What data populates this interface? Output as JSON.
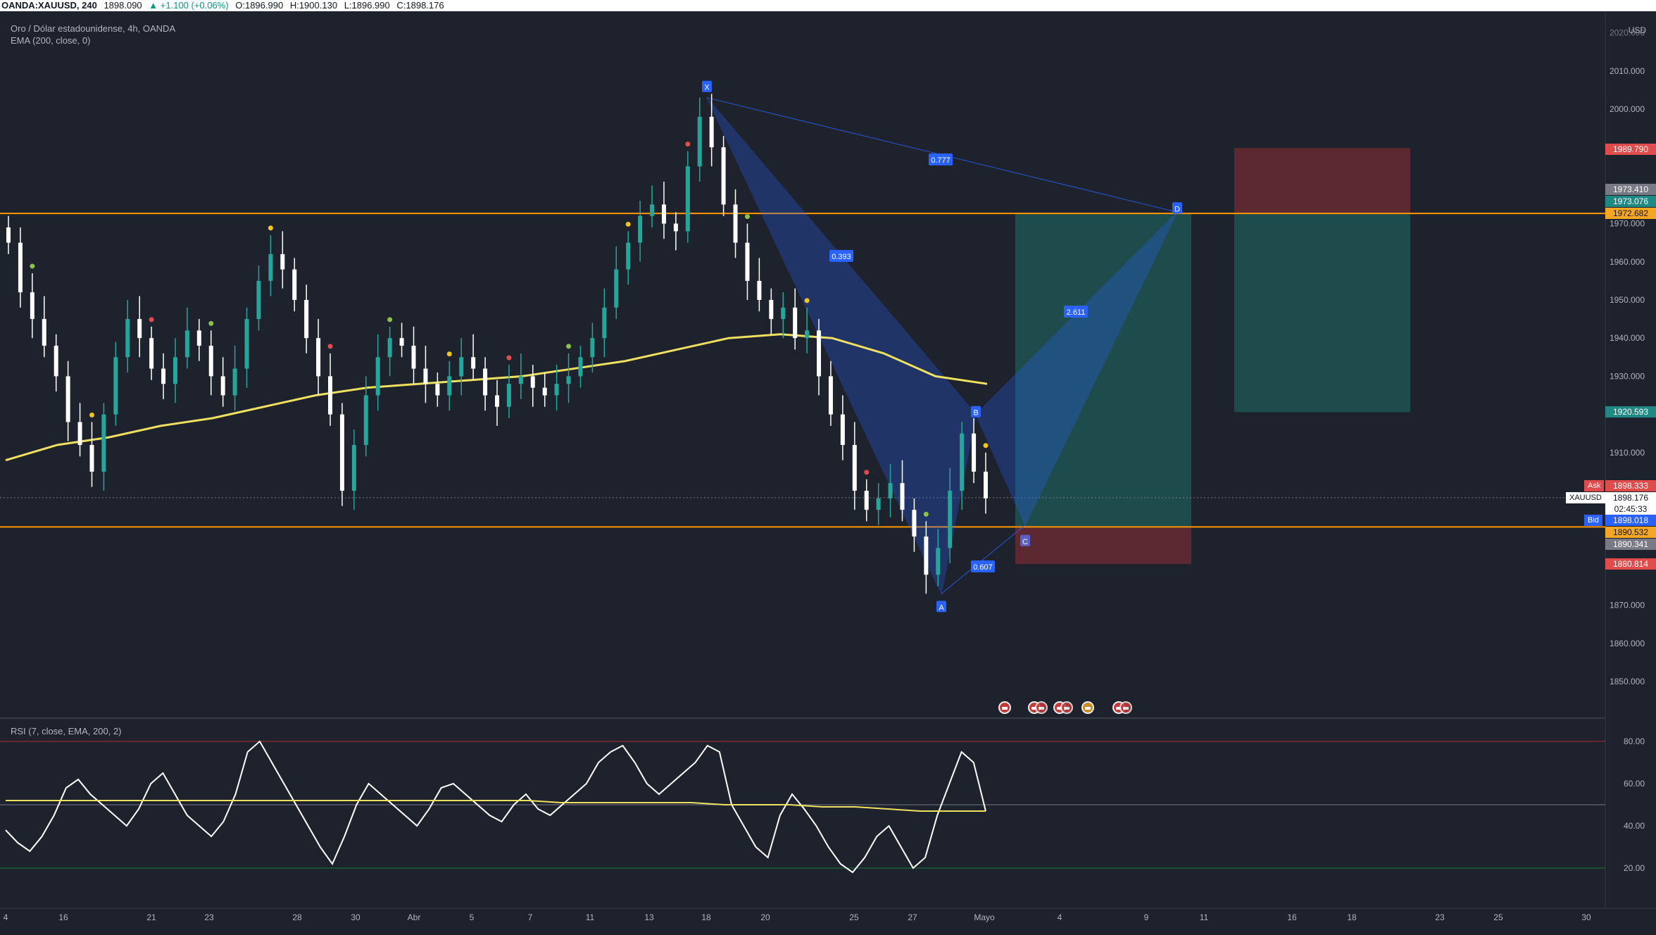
{
  "header": {
    "symbol": "OANDA:XAUUSD, 240",
    "last": "1898.090",
    "change": "▲ +1.100 (+0.06%)",
    "open": "O:1896.990",
    "high": "H:1900.130",
    "low": "L:1896.990",
    "close": "C:1898.176"
  },
  "legends": {
    "main": "Oro / Dólar estadounidense, 4h, OANDA",
    "ema": "EMA (200, close, 0)",
    "rsi": "RSI (7, close, EMA, 200, 2)"
  },
  "price_axis": {
    "currency": "USD",
    "ticks": [
      "2010.000",
      "2000.000",
      "1970.000",
      "1960.000",
      "1950.000",
      "1940.000",
      "1930.000",
      "1910.000",
      "1870.000",
      "1860.000",
      "1850.000"
    ],
    "top_partial": "2020.000"
  },
  "price_tags": {
    "sl_top": "1989.790",
    "t1": "1973.410",
    "t2": "1973.076",
    "resistance": "1972.682",
    "tp_low": "1920.593",
    "ask": "1898.333",
    "last": "1898.176",
    "countdown": "02:45:33",
    "bid": "1898.018",
    "support": "1890.532",
    "s2": "1890.341",
    "sl_bottom": "1880.814",
    "ask_label": "Ask",
    "bid_label": "Bid",
    "symbol_label": "XAUUSD"
  },
  "rsi_axis": {
    "ticks": [
      "80.00",
      "60.00",
      "40.00",
      "20.00"
    ]
  },
  "time_axis": {
    "labels": [
      "4",
      "16",
      "21",
      "23",
      "28",
      "30",
      "Abr",
      "5",
      "7",
      "11",
      "13",
      "18",
      "20",
      "25",
      "27",
      "Mayo",
      "4",
      "9",
      "11",
      "16",
      "18",
      "23",
      "25",
      "30"
    ]
  },
  "pattern": {
    "points": [
      "X",
      "A",
      "B",
      "C",
      "D"
    ],
    "ratios": [
      "0.777",
      "0.393",
      "2.611",
      "0.607"
    ]
  },
  "colors": {
    "background": "#1e222d",
    "up": "#26a69a",
    "down": "#ffffff",
    "ema": "#f0e060",
    "level": "#ff9800",
    "pattern": "#2962ff",
    "profit": "#1f5a57",
    "loss": "#6b2c33"
  },
  "chart_data": {
    "type": "candlestick",
    "title": "Oro / Dólar estadounidense, 4h, OANDA",
    "ylim": [
      1840,
      2025
    ],
    "levels": [
      1972.682,
      1890.532
    ],
    "ema_200": [
      1908,
      1912,
      1914,
      1917,
      1919,
      1922,
      1925,
      1927,
      1928,
      1929,
      1930,
      1932,
      1934,
      1937,
      1940,
      1941,
      1940,
      1936,
      1930,
      1928
    ],
    "closes": [
      1965,
      1952,
      1945,
      1938,
      1930,
      1918,
      1912,
      1905,
      1920,
      1935,
      1945,
      1940,
      1932,
      1928,
      1935,
      1942,
      1938,
      1930,
      1925,
      1932,
      1945,
      1955,
      1962,
      1958,
      1950,
      1940,
      1930,
      1920,
      1900,
      1912,
      1925,
      1935,
      1940,
      1938,
      1932,
      1928,
      1925,
      1930,
      1935,
      1932,
      1925,
      1922,
      1928,
      1930,
      1927,
      1925,
      1928,
      1930,
      1935,
      1940,
      1948,
      1958,
      1965,
      1972,
      1975,
      1970,
      1968,
      1985,
      1998,
      1990,
      1975,
      1965,
      1955,
      1950,
      1945,
      1948,
      1940,
      1942,
      1930,
      1920,
      1912,
      1900,
      1895,
      1898,
      1902,
      1895,
      1888,
      1878,
      1885,
      1900,
      1915,
      1905,
      1898
    ],
    "rsi": [
      38,
      32,
      28,
      35,
      45,
      58,
      62,
      55,
      50,
      45,
      40,
      48,
      60,
      65,
      55,
      45,
      40,
      35,
      42,
      55,
      75,
      80,
      70,
      60,
      50,
      40,
      30,
      22,
      35,
      50,
      60,
      55,
      50,
      45,
      40,
      48,
      58,
      60,
      55,
      50,
      45,
      42,
      50,
      55,
      48,
      45,
      50,
      55,
      60,
      70,
      75,
      78,
      70,
      60,
      55,
      60,
      65,
      70,
      78,
      75,
      50,
      40,
      30,
      25,
      45,
      55,
      48,
      40,
      30,
      22,
      18,
      25,
      35,
      40,
      30,
      20,
      25,
      45,
      60,
      75,
      70,
      47
    ],
    "rsi_ema": [
      52,
      52,
      52,
      52,
      52,
      52,
      52,
      52,
      52,
      52,
      52,
      52,
      52,
      52,
      52,
      52,
      52,
      51,
      51,
      51,
      51,
      51,
      50,
      50,
      50,
      49,
      49,
      48,
      47,
      47,
      47
    ],
    "rsi_levels": [
      80,
      50,
      20
    ],
    "harmonic": {
      "X": 2003,
      "A": 1873,
      "B": 1920,
      "C": 1891,
      "D": 1973,
      "XD": 0.777,
      "XB": 0.393,
      "BD": 2.611,
      "AC": 0.607
    },
    "position_long": {
      "entry": 1890.532,
      "target": 1972.682,
      "stop": 1880.814
    },
    "position_short": {
      "entry": 1972.682,
      "target": 1920.593,
      "stop": 1989.79
    }
  }
}
